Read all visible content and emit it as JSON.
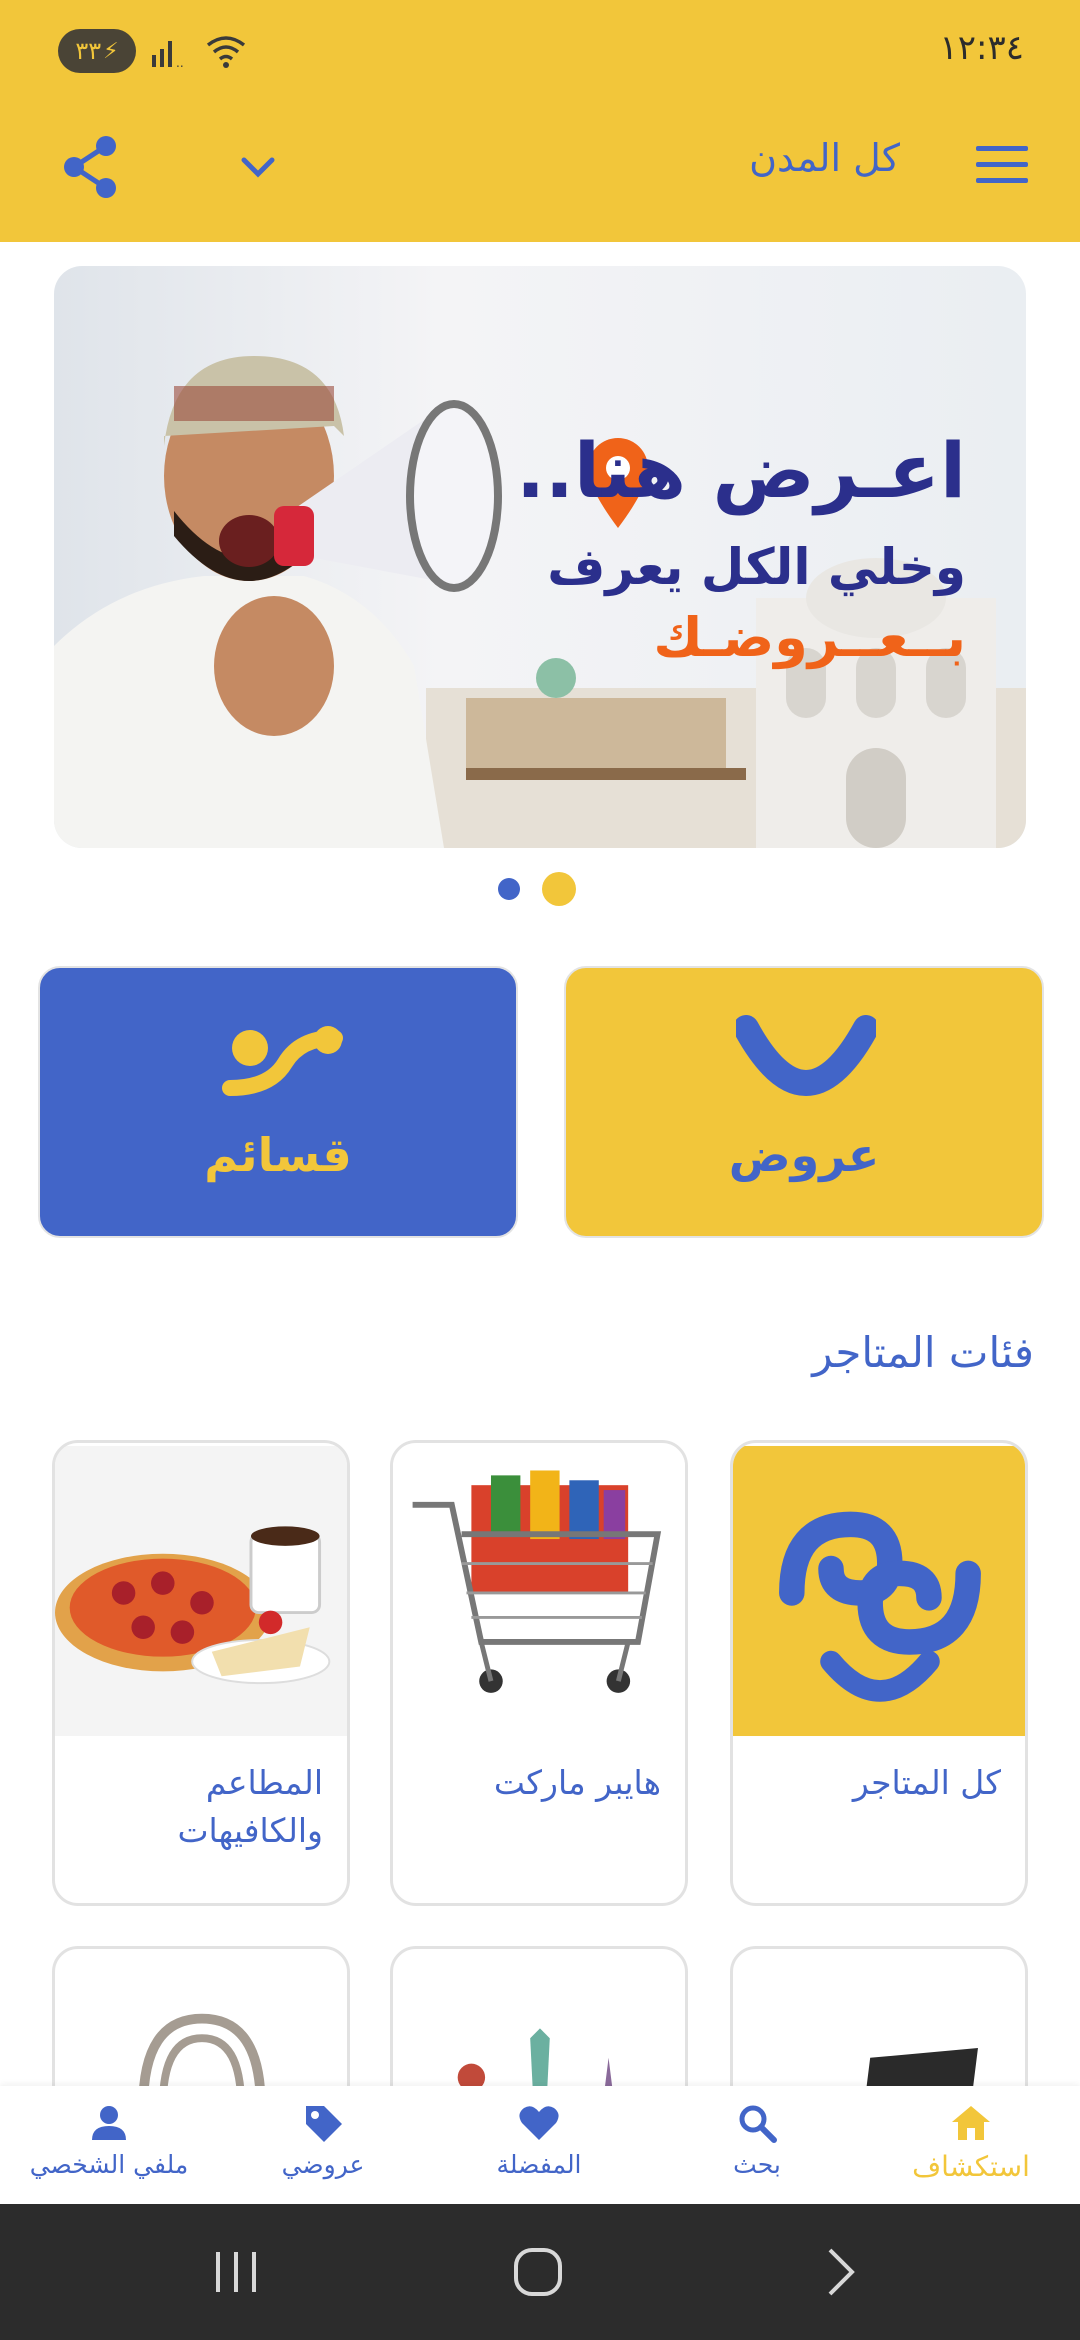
{
  "status_bar": {
    "battery": "٣٣",
    "time": "١٢:٣٤"
  },
  "header": {
    "city": "كل المدن",
    "icons": [
      "share-icon",
      "chevron-down-icon",
      "menu-icon"
    ]
  },
  "banner": {
    "headline": "اعـرض هنا..",
    "line2": "وخلي الكل يعرف",
    "line3": "بــعــروضـك",
    "slides": 2,
    "active_slide": 2
  },
  "tiles": [
    {
      "label": "عروض",
      "color": "#F2C63A"
    },
    {
      "label": "قسائم",
      "color": "#4265C8"
    }
  ],
  "section": {
    "title": "فئات المتاجر"
  },
  "categories": [
    {
      "label": "كل المتاجر",
      "image": "brand-logo"
    },
    {
      "label": "هايبر ماركت",
      "image": "shopping-cart"
    },
    {
      "label": "المطاعم والكافيهات",
      "image": "pizza-coffee"
    },
    {
      "label": "",
      "image": "electronics"
    },
    {
      "label": "",
      "image": "travel"
    },
    {
      "label": "",
      "image": "handbag"
    }
  ],
  "bottom_nav": [
    {
      "label": "استكشاف",
      "icon": "home-icon",
      "active": true
    },
    {
      "label": "بحث",
      "icon": "search-icon"
    },
    {
      "label": "المفضلة",
      "icon": "heart-icon"
    },
    {
      "label": "عروضي",
      "icon": "tag-icon"
    },
    {
      "label": "ملفي الشخصي",
      "icon": "person-icon"
    }
  ],
  "colors": {
    "primary": "#F2C63A",
    "accent": "#4265C8",
    "orange": "#F06319"
  }
}
